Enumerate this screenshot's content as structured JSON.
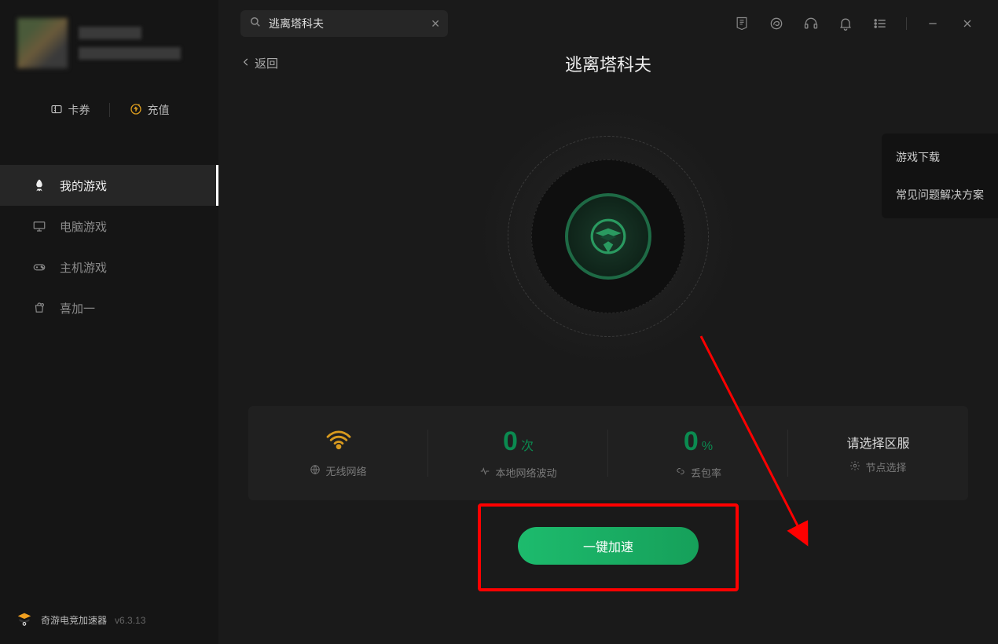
{
  "sidebar": {
    "coupons_label": "卡券",
    "recharge_label": "充值",
    "nav": {
      "my_games": "我的游戏",
      "pc_games": "电脑游戏",
      "console_games": "主机游戏",
      "plus_one": "喜加一"
    },
    "footer_name": "奇游电竞加速器",
    "footer_version": "v6.3.13"
  },
  "search": {
    "value": "逃离塔科夫"
  },
  "header": {
    "back_label": "返回",
    "page_title": "逃离塔科夫"
  },
  "side_panel": {
    "download": "游戏下载",
    "faq": "常见问题解决方案"
  },
  "stats": {
    "network_type_label": "无线网络",
    "jitter_value": "0",
    "jitter_unit": "次",
    "jitter_label": "本地网络波动",
    "loss_value": "0",
    "loss_unit": "%",
    "loss_label": "丢包率",
    "region_title": "请选择区服",
    "region_sub": "节点选择"
  },
  "cta": {
    "label": "一键加速"
  }
}
